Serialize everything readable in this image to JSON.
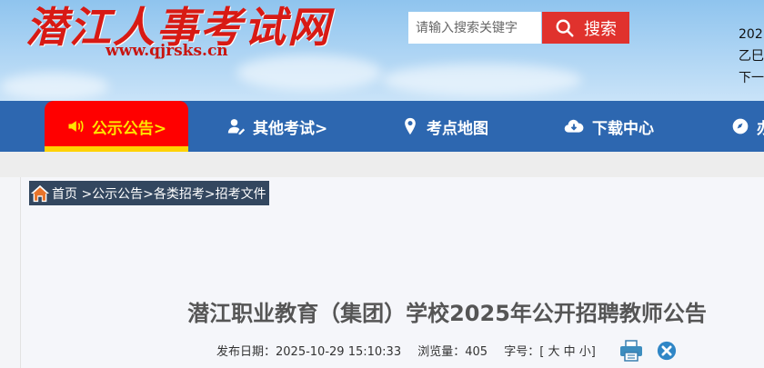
{
  "header": {
    "logo_text": "潜江人事考试网",
    "logo_url": "www.qjrsks.cn",
    "search_placeholder": "请输入搜索关键字",
    "search_button": "搜索",
    "date_line1": "202",
    "date_line2": "乙巳",
    "date_line3": "下一节"
  },
  "nav": {
    "items": [
      {
        "label": "公示公告>",
        "icon": "megaphone-icon"
      },
      {
        "label": "其他考试>",
        "icon": "user-edit-icon"
      },
      {
        "label": "考点地图",
        "icon": "map-marker-icon"
      },
      {
        "label": "下载中心",
        "icon": "cloud-download-icon"
      },
      {
        "label": "办",
        "icon": "compass-icon"
      }
    ]
  },
  "breadcrumb": {
    "home": "首页",
    "path": ">公示公告>各类招考>招考文件"
  },
  "article": {
    "title": "潜江职业教育（集团）学校2025年公开招聘教师公告",
    "publish_label": "发布日期：",
    "publish_date": "2025-10-29 15:10:33",
    "views_label": "浏览量：",
    "views": "405",
    "fontsize_label": "字号：[",
    "fs_large": "大",
    "fs_medium": "中",
    "fs_small": "小",
    "fontsize_end": "]"
  },
  "colors": {
    "nav_bg": "#2d67b0",
    "active_tab": "#ff0000",
    "active_text": "#ffe400",
    "search_btn": "#e0322d",
    "logo": "#d81a14"
  }
}
